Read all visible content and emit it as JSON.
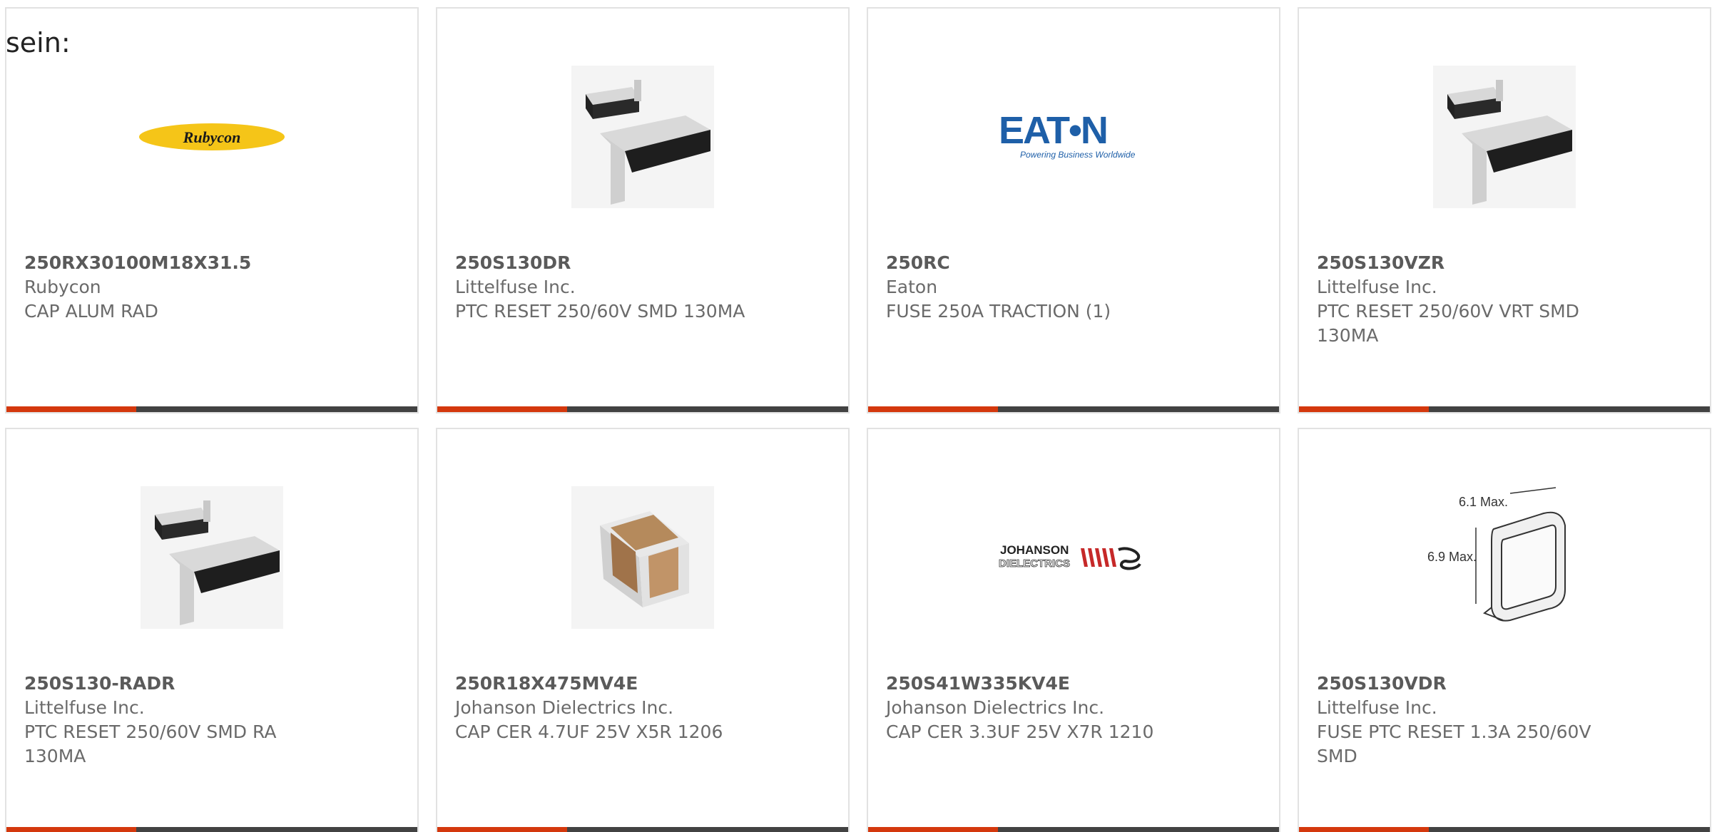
{
  "overlay_text": "sein:",
  "cards": [
    {
      "part_number": "250RX30100M18X31.5",
      "manufacturer": "Rubycon",
      "description": "CAP ALUM RAD",
      "image": "rubycon-logo",
      "logo_text": "Rubycon"
    },
    {
      "part_number": "250S130DR",
      "manufacturer": "Littelfuse Inc.",
      "description": "PTC RESET 250/60V SMD 130MA",
      "image": "ptc-smd-component"
    },
    {
      "part_number": "250RC",
      "manufacturer": "Eaton",
      "description": "FUSE 250A TRACTION (1)",
      "image": "eaton-logo",
      "logo_text": "EAT•N",
      "logo_tagline": "Powering Business Worldwide"
    },
    {
      "part_number": "250S130VZR",
      "manufacturer": "Littelfuse Inc.",
      "description": "PTC RESET 250/60V VRT SMD 130MA",
      "image": "ptc-smd-component"
    },
    {
      "part_number": "250S130-RADR",
      "manufacturer": "Littelfuse Inc.",
      "description": "PTC RESET 250/60V SMD RA 130MA",
      "image": "ptc-smd-component"
    },
    {
      "part_number": "250R18X475MV4E",
      "manufacturer": "Johanson Dielectrics Inc.",
      "description": "CAP CER 4.7UF 25V X5R 1206",
      "image": "ceramic-chip-capacitor"
    },
    {
      "part_number": "250S41W335KV4E",
      "manufacturer": "Johanson Dielectrics Inc.",
      "description": "CAP CER 3.3UF 25V X7R 1210",
      "image": "johanson-logo",
      "logo_text": "JOHANSON",
      "logo_text2": "DIELECTRICS"
    },
    {
      "part_number": "250S130VDR",
      "manufacturer": "Littelfuse Inc.",
      "description": "FUSE PTC RESET 1.3A 250/60V SMD",
      "image": "ptc-dimension-drawing",
      "dim1": "6.1 Max.",
      "dim2": "6.9 Max."
    }
  ],
  "colors": {
    "accent": "#d4380d",
    "bar": "#424242",
    "border": "#e2e2e2"
  }
}
